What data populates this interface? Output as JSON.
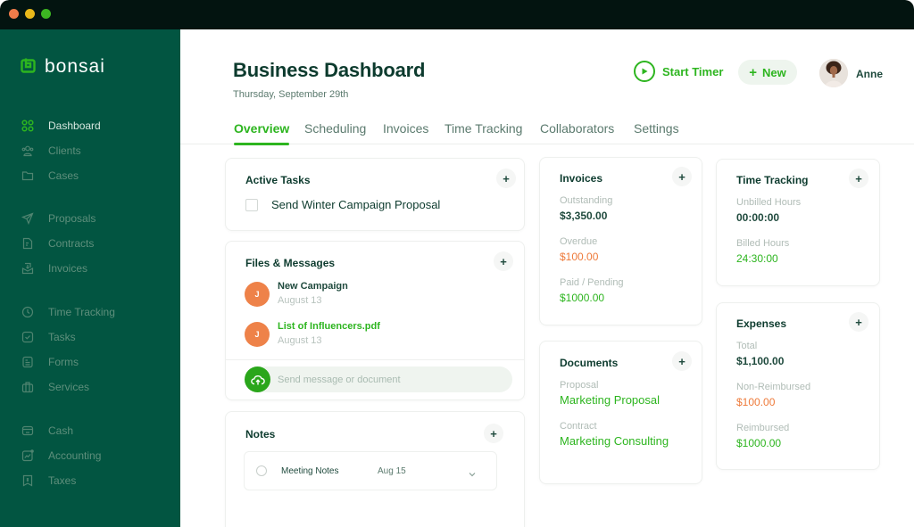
{
  "window": {
    "controls": [
      "close",
      "minimize",
      "maximize"
    ]
  },
  "sidebar": {
    "brand": "bonsai",
    "items": [
      {
        "label": "Dashboard",
        "icon": "grid-icon",
        "active": true
      },
      {
        "label": "Clients",
        "icon": "users-icon",
        "active": false
      },
      {
        "label": "Cases",
        "icon": "folder-icon",
        "active": false
      },
      {
        "label": "Proposals",
        "icon": "send-icon",
        "active": false
      },
      {
        "label": "Contracts",
        "icon": "contract-icon",
        "active": false
      },
      {
        "label": "Invoices",
        "icon": "invoice-icon",
        "active": false
      },
      {
        "label": "Time Tracking",
        "icon": "clock-icon",
        "active": false
      },
      {
        "label": "Tasks",
        "icon": "task-check-icon",
        "active": false
      },
      {
        "label": "Forms",
        "icon": "form-icon",
        "active": false
      },
      {
        "label": "Services",
        "icon": "briefcase-icon",
        "active": false
      },
      {
        "label": "Cash",
        "icon": "card-icon",
        "active": false
      },
      {
        "label": "Accounting",
        "icon": "chart-icon",
        "active": false
      },
      {
        "label": "Taxes",
        "icon": "tax-icon",
        "active": false
      }
    ]
  },
  "header": {
    "title": "Business Dashboard",
    "date": "Thursday, September 29th",
    "start_timer_label": "Start Timer",
    "new_label": "New",
    "new_icon": "+",
    "user_name": "Anne"
  },
  "tabs": [
    {
      "label": "Overview",
      "active": true
    },
    {
      "label": "Scheduling",
      "active": false
    },
    {
      "label": "Invoices",
      "active": false
    },
    {
      "label": "Time Tracking",
      "active": false
    },
    {
      "label": "Collaborators",
      "active": false
    },
    {
      "label": "Settings",
      "active": false
    }
  ],
  "active_tasks": {
    "title": "Active Tasks",
    "add": "+",
    "items": [
      {
        "label": "Send Winter Campaign Proposal",
        "checked": false
      }
    ]
  },
  "files_messages": {
    "title": "Files & Messages",
    "add": "+",
    "items": [
      {
        "initial": "J",
        "title": "New Campaign",
        "date": "August 13",
        "is_file": false
      },
      {
        "initial": "J",
        "title": "List of Influencers.pdf",
        "date": "August 13",
        "is_file": true
      }
    ],
    "input_placeholder": "Send message or document"
  },
  "notes": {
    "title": "Notes",
    "add": "+",
    "items": [
      {
        "title": "Meeting Notes",
        "date": "Aug 15"
      }
    ]
  },
  "invoices": {
    "title": "Invoices",
    "add": "+",
    "stats": [
      {
        "label": "Outstanding",
        "value": "$3,350.00",
        "tone": "default"
      },
      {
        "label": "Overdue",
        "value": "$100.00",
        "tone": "orange"
      },
      {
        "label": "Paid / Pending",
        "value": "$1000.00",
        "tone": "green"
      }
    ]
  },
  "documents": {
    "title": "Documents",
    "add": "+",
    "items": [
      {
        "label": "Proposal",
        "value": "Marketing Proposal"
      },
      {
        "label": "Contract",
        "value": "Marketing Consulting"
      }
    ]
  },
  "time_tracking": {
    "title": "Time Tracking",
    "add": "+",
    "stats": [
      {
        "label": "Unbilled Hours",
        "value": "00:00:00",
        "tone": "default"
      },
      {
        "label": "Billed Hours",
        "value": "24:30:00",
        "tone": "green"
      }
    ]
  },
  "expenses": {
    "title": "Expenses",
    "add": "+",
    "stats": [
      {
        "label": "Total",
        "value": "$1,100.00",
        "tone": "default"
      },
      {
        "label": "Non-Reimbursed",
        "value": "$100.00",
        "tone": "orange"
      },
      {
        "label": "Reimbursed",
        "value": "$1000.00",
        "tone": "green"
      }
    ]
  },
  "colors": {
    "sidebar_bg": "#025541",
    "accent_green": "#2db51f",
    "orange": "#ee7a3a",
    "dark_text": "#0d3b2e"
  }
}
